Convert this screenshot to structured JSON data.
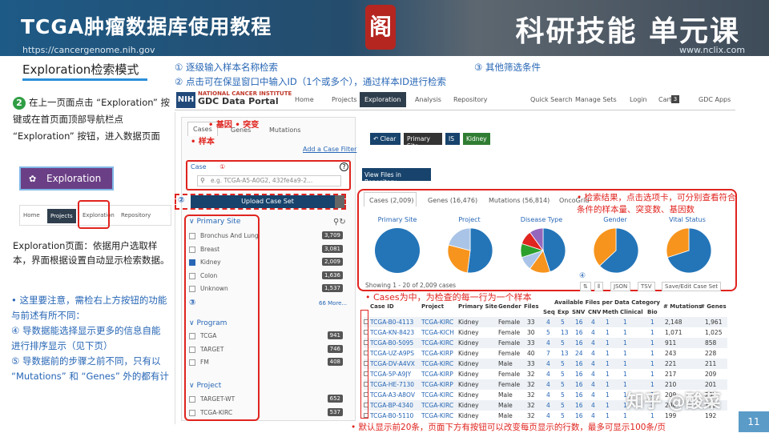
{
  "header": {
    "title_left": "TCGA肿瘤数据库使用教程",
    "title_right": "科研技能 单元课",
    "url_left": "https://cancergenome.nih.gov",
    "url_right": "www.nclix.com",
    "seal_text": "阁"
  },
  "slide": {
    "mode_title": "Exploration检索模式",
    "note1": "① 逐级输入样本名称检索",
    "note2": "② 点击可在保显窗口中输入ID（1个或多个），通过样本ID进行检索",
    "note3": "③ 其他筛选条件",
    "step2_num": "2",
    "step2_text": "在上一页面点击 “Exploration” 按键或在首页面顶部导航栏点 “Exploration” 按钮，进入数据页面",
    "explore_bar_label": "Exploration",
    "explore_desc": "Exploration页面：依据用户选取样本，界面根据设置自动显示检索数据。",
    "bullets": [
      "• 这里要注意，需检右上方按钮的功能",
      "  与前述有所不同：",
      "  ④ 导数据能选择显示更多的信息自能",
      "  进行排序显示（见下页）",
      "  ⑤ 导数据前的步骤之前不同，只有以",
      "  “Mutations” 和 “Genes” 外的都有计"
    ],
    "mini_nav": [
      "Home",
      "Projects",
      "Exploration",
      "Repository"
    ]
  },
  "gdc": {
    "nih": "NIH",
    "institute": "NATIONAL CANCER INSTITUTE",
    "portal_name": "GDC Data Portal",
    "nav": [
      "Home",
      "Projects",
      "Exploration",
      "Analysis",
      "Repository",
      "Quick Search",
      "Manage Sets",
      "Login",
      "Cart",
      "GDC Apps"
    ],
    "cart_count": "3",
    "left_tabs": [
      "Cases",
      "Genes",
      "Mutations"
    ],
    "red_labels": "• 基因  • 突变",
    "sample_label": "• 样本",
    "add_filter": "Add a Case Filter",
    "case_label": "Case",
    "case_num": "①",
    "case_placeholder": "e.g. TCGA-A5-A0G2, 432fe4a9-2...",
    "upload_label": "Upload Case Set",
    "upload_num": "②",
    "facet_num": "③",
    "more_label": "66 More...",
    "facets": [
      {
        "title": "Primary Site",
        "rows": [
          {
            "label": "Bronchus And Lung",
            "count": "3,709",
            "checked": false
          },
          {
            "label": "Breast",
            "count": "3,081",
            "checked": false
          },
          {
            "label": "Kidney",
            "count": "2,009",
            "checked": true
          },
          {
            "label": "Colon",
            "count": "1,636",
            "checked": false
          },
          {
            "label": "Unknown",
            "count": "1,537",
            "checked": false
          }
        ]
      },
      {
        "title": "Program",
        "rows": [
          {
            "label": "TCGA",
            "count": "941",
            "checked": false
          },
          {
            "label": "TARGET",
            "count": "746",
            "checked": false
          },
          {
            "label": "FM",
            "count": "408",
            "checked": false
          }
        ]
      },
      {
        "title": "Project",
        "rows": [
          {
            "label": "TARGET-WT",
            "count": "652",
            "checked": false
          },
          {
            "label": "TCGA-KIRC",
            "count": "537",
            "checked": false
          }
        ]
      }
    ],
    "filter_buttons": [
      "Clear",
      "Primary Site",
      "IS",
      "Kidney"
    ],
    "view_files": "View Files in Repository",
    "result_tabs": [
      "Cases (2,009)",
      "Genes (16,476)",
      "Mutations (56,814)",
      "OncoGrid"
    ],
    "pie_titles": [
      "Primary Site",
      "Project",
      "Disease Type",
      "Gender",
      "Vital Status"
    ],
    "annot_results": "• 检索结果，点击选项卡，可分别查看符合条件的样本量、突变数、基因数",
    "tiny_n4": "④",
    "table_controls": [
      "JSON",
      "TSV",
      "Save/Edit Case Set"
    ],
    "showing": "Showing 1 - 20 of 2,009 cases",
    "caption_cases": "• Cases为中，为检查的每一行为一个样本",
    "table_headers": {
      "case_id": "Case ID",
      "project": "Project",
      "primary_site": "Primary Site",
      "gender": "Gender",
      "files": "Files",
      "avail": "Available Files per Data Category",
      "sub": [
        "Seq",
        "Exp",
        "SNV",
        "CNV",
        "Meth",
        "Clinical",
        "Bio"
      ],
      "mutations": "# Mutations",
      "genes": "# Genes"
    },
    "table_rows": [
      {
        "id": "TCGA-B0-4113",
        "project": "TCGA-KIRC",
        "site": "Kidney",
        "gender": "Female",
        "files": "33",
        "cats": [
          "4",
          "5",
          "16",
          "4",
          "1",
          "1",
          "1"
        ],
        "mut": "2,148",
        "genes": "1,961"
      },
      {
        "id": "TCGA-KN-8423",
        "project": "TCGA-KICH",
        "site": "Kidney",
        "gender": "Female",
        "files": "30",
        "cats": [
          "5",
          "13",
          "16",
          "4",
          "1",
          "1",
          "1"
        ],
        "mut": "1,071",
        "genes": "1,025"
      },
      {
        "id": "TCGA-B0-5095",
        "project": "TCGA-KIRC",
        "site": "Kidney",
        "gender": "Female",
        "files": "33",
        "cats": [
          "4",
          "5",
          "16",
          "4",
          "1",
          "1",
          "1"
        ],
        "mut": "911",
        "genes": "858"
      },
      {
        "id": "TCGA-UZ-A9PS",
        "project": "TCGA-KIRP",
        "site": "Kidney",
        "gender": "Female",
        "files": "40",
        "cats": [
          "7",
          "13",
          "24",
          "4",
          "1",
          "1",
          "1"
        ],
        "mut": "243",
        "genes": "228"
      },
      {
        "id": "TCGA-DV-A4VX",
        "project": "TCGA-KIRC",
        "site": "Kidney",
        "gender": "Male",
        "files": "33",
        "cats": [
          "4",
          "5",
          "16",
          "4",
          "1",
          "1",
          "1"
        ],
        "mut": "221",
        "genes": "211"
      },
      {
        "id": "TCGA-5P-A9JY",
        "project": "TCGA-KIRP",
        "site": "Kidney",
        "gender": "Female",
        "files": "32",
        "cats": [
          "4",
          "5",
          "16",
          "4",
          "1",
          "1",
          "1"
        ],
        "mut": "217",
        "genes": "209"
      },
      {
        "id": "TCGA-HE-7130",
        "project": "TCGA-KIRP",
        "site": "Kidney",
        "gender": "Female",
        "files": "32",
        "cats": [
          "4",
          "5",
          "16",
          "4",
          "1",
          "1",
          "1"
        ],
        "mut": "210",
        "genes": "201"
      },
      {
        "id": "TCGA-A3-A8OV",
        "project": "TCGA-KIRC",
        "site": "Kidney",
        "gender": "Male",
        "files": "32",
        "cats": [
          "4",
          "5",
          "16",
          "4",
          "1",
          "1",
          "1"
        ],
        "mut": "209",
        "genes": "201"
      },
      {
        "id": "TCGA-BP-4340",
        "project": "TCGA-KIRC",
        "site": "Kidney",
        "gender": "Male",
        "files": "32",
        "cats": [
          "4",
          "5",
          "16",
          "4",
          "1",
          "1",
          "1"
        ],
        "mut": "204",
        "genes": "195"
      },
      {
        "id": "TCGA-B0-5110",
        "project": "TCGA-KIRC",
        "site": "Kidney",
        "gender": "Male",
        "files": "32",
        "cats": [
          "4",
          "5",
          "16",
          "4",
          "1",
          "1",
          "1"
        ],
        "mut": "199",
        "genes": "192"
      }
    ],
    "pie_colors": [
      "#2475b8",
      "#f7941d",
      "#a9c4e6",
      "#2ca02c",
      "#e0241f",
      "#9467bd"
    ],
    "pies": [
      [
        1
      ],
      [
        0.52,
        0.27,
        0.21
      ],
      [
        0.45,
        0.15,
        0.1,
        0.1,
        0.1,
        0.1
      ],
      [
        0.63,
        0.37
      ],
      [
        0.7,
        0.3
      ]
    ]
  },
  "footer": {
    "bottom_note": "• 默认显示前20条，页面下方有按钮可以改变每页显示的行数，最多可显示100条/页",
    "watermark": "知乎 @酸菜",
    "page_number": "11"
  },
  "colors": {
    "accent_red": "#e0241f",
    "accent_blue": "#2766b5",
    "gdc_dark": "#17436c"
  }
}
